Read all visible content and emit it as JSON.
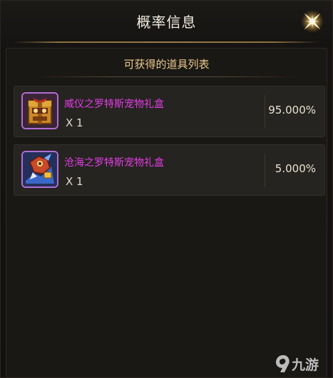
{
  "window": {
    "title": "概率信息",
    "close_icon": "sparkle-close-icon"
  },
  "section": {
    "subtitle": "可获得的道具列表"
  },
  "items": [
    {
      "name": "威仪之罗特斯宠物礼盒",
      "quantity": "X 1",
      "probability": "95.000%",
      "icon": "gift-box-pet-icon"
    },
    {
      "name": "沧海之罗特斯宠物礼盒",
      "quantity": "X 1",
      "probability": "5.000%",
      "icon": "blue-pet-box-icon"
    }
  ],
  "watermark": {
    "text": "九游",
    "icon": "jiuyou-logo-icon"
  },
  "colors": {
    "item_name": "#e23de6",
    "subtitle": "#e9c88b",
    "icon_border": "#b16dd8"
  }
}
